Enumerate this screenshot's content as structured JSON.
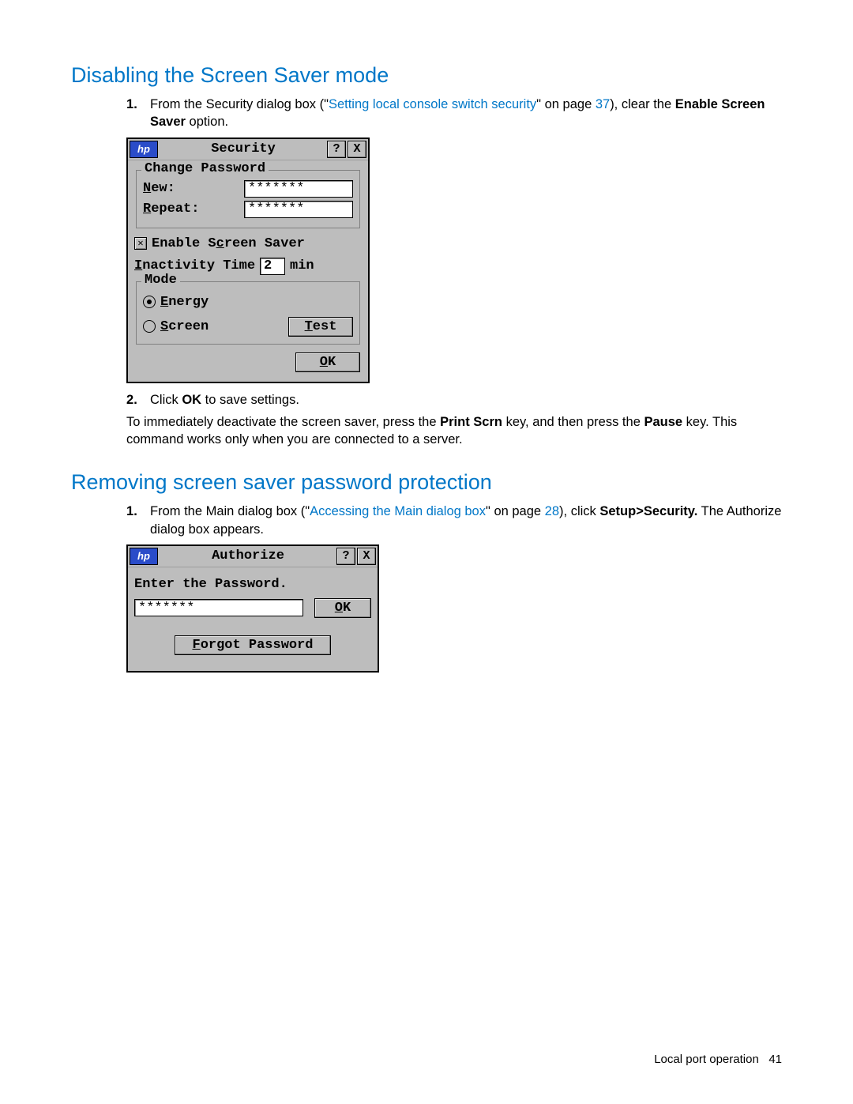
{
  "section1": {
    "heading": "Disabling the Screen Saver mode",
    "step1_a": "From the Security dialog box (\"",
    "step1_link": "Setting local console switch security",
    "step1_b": "\" on page ",
    "step1_page": "37",
    "step1_c": "), clear the ",
    "step1_bold": "Enable Screen Saver",
    "step1_d": " option.",
    "step2_a": "Click ",
    "step2_bold": "OK",
    "step2_b": " to save settings.",
    "after_a": "To immediately deactivate the screen saver, press the ",
    "after_b1": "Print Scrn",
    "after_c": " key, and then press the ",
    "after_b2": "Pause",
    "after_d": " key. This command works only when you are connected to a server."
  },
  "security_dialog": {
    "title": "Security",
    "help": "?",
    "close": "X",
    "group_password": "Change Password",
    "new_label_ul": "N",
    "new_label_rest": "ew:",
    "repeat_label_ul": "R",
    "repeat_label_rest": "epeat:",
    "pw_value": "*******",
    "enable_ss_pre": "Enable S",
    "enable_ss_ul": "c",
    "enable_ss_post": "reen Saver",
    "inactivity_pre_ul": "I",
    "inactivity_post": "nactivity Time",
    "inactivity_value": "2",
    "inactivity_unit": "min",
    "mode_legend": "Mode",
    "mode_energy_ul": "E",
    "mode_energy_post": "nergy",
    "mode_screen_ul": "S",
    "mode_screen_post": "creen",
    "test_ul": "T",
    "test_post": "est",
    "ok_ul": "O",
    "ok_post": "K"
  },
  "section2": {
    "heading": "Removing screen saver password protection",
    "step1_a": "From the Main dialog box (\"",
    "step1_link": "Accessing the Main dialog box",
    "step1_b": "\" on page ",
    "step1_page": "28",
    "step1_c": "), click ",
    "step1_bold": "Setup>Security.",
    "step1_d": " The Authorize dialog box appears."
  },
  "authorize_dialog": {
    "title": "Authorize",
    "help": "?",
    "close": "X",
    "prompt": "Enter the Password.",
    "pw_value": "*******",
    "ok_ul": "O",
    "ok_post": "K",
    "forgot_ul": "F",
    "forgot_post": "orgot Password"
  },
  "footer": {
    "text": "Local port operation",
    "page": "41"
  }
}
